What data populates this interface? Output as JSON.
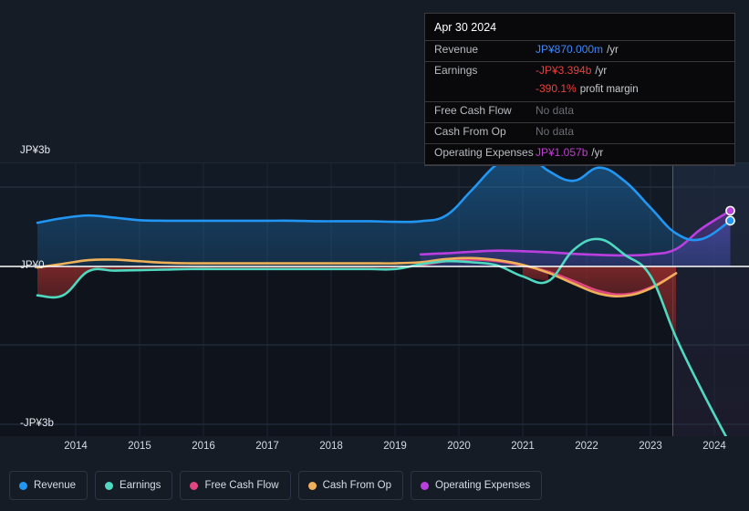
{
  "axis": {
    "y_labels": {
      "top": "JP¥3b",
      "zero": "JP¥0",
      "bottom": "-JP¥3b"
    },
    "x_labels": [
      "2014",
      "2015",
      "2016",
      "2017",
      "2018",
      "2019",
      "2020",
      "2021",
      "2022",
      "2023",
      "2024"
    ]
  },
  "tooltip": {
    "date": "Apr 30 2024",
    "rows": [
      {
        "key": "Revenue",
        "value": "JP¥870.000m",
        "unit": "/yr",
        "style": "rev"
      },
      {
        "key": "Earnings",
        "value": "-JP¥3.394b",
        "unit": "/yr",
        "style": "neg"
      },
      {
        "key": "",
        "value": "-390.1%",
        "unit": "profit margin",
        "style": "neg"
      },
      {
        "key": "Free Cash Flow",
        "value": "No data",
        "unit": "",
        "style": "nodata"
      },
      {
        "key": "Cash From Op",
        "value": "No data",
        "unit": "",
        "style": "nodata"
      },
      {
        "key": "Operating Expenses",
        "value": "JP¥1.057b",
        "unit": "/yr",
        "style": "opex"
      }
    ]
  },
  "legend": [
    {
      "label": "Revenue",
      "color": "#2196f3"
    },
    {
      "label": "Earnings",
      "color": "#4fd9c0"
    },
    {
      "label": "Free Cash Flow",
      "color": "#e0467f"
    },
    {
      "label": "Cash From Op",
      "color": "#efb05a"
    },
    {
      "label": "Operating Expenses",
      "color": "#bb3fe0"
    }
  ],
  "chart_data": {
    "type": "area",
    "title": "",
    "xlabel": "",
    "ylabel": "JP¥",
    "ylim": [
      -3.6,
      3.6
    ],
    "grid": true,
    "legend_position": "bottom",
    "currency": "JP¥",
    "zero_line": 0,
    "forecast_divider_year": 2023.35,
    "x": [
      2013.4,
      2013.8,
      2014.2,
      2014.6,
      2015.0,
      2015.4,
      2015.8,
      2016.2,
      2016.6,
      2017.0,
      2017.4,
      2017.8,
      2018.2,
      2018.6,
      2019.0,
      2019.4,
      2019.8,
      2020.2,
      2020.6,
      2021.0,
      2021.4,
      2021.8,
      2022.2,
      2022.6,
      2023.0,
      2023.4,
      2023.8,
      2024.25
    ],
    "series": [
      {
        "name": "Revenue",
        "color": "#2196f3",
        "values": [
          0.83,
          0.92,
          0.97,
          0.93,
          0.88,
          0.87,
          0.87,
          0.87,
          0.87,
          0.87,
          0.87,
          0.86,
          0.86,
          0.86,
          0.85,
          0.86,
          0.97,
          1.45,
          1.95,
          2.18,
          1.82,
          1.63,
          1.88,
          1.62,
          1.12,
          0.63,
          0.52,
          0.87
        ]
      },
      {
        "name": "Earnings",
        "color": "#4fd9c0",
        "values": [
          -0.55,
          -0.55,
          -0.09,
          -0.08,
          -0.07,
          -0.06,
          -0.05,
          -0.05,
          -0.05,
          -0.05,
          -0.05,
          -0.05,
          -0.05,
          -0.05,
          -0.05,
          0.04,
          0.1,
          0.08,
          0.02,
          -0.19,
          -0.28,
          0.32,
          0.52,
          0.22,
          -0.18,
          -1.35,
          -2.35,
          -3.39
        ]
      },
      {
        "name": "Free Cash Flow",
        "color": "#e0467f",
        "values": [
          null,
          null,
          null,
          null,
          null,
          null,
          null,
          null,
          null,
          null,
          null,
          null,
          null,
          null,
          null,
          0.02,
          0.1,
          0.13,
          0.1,
          0.02,
          -0.1,
          -0.28,
          -0.47,
          -0.53,
          -0.4,
          -0.13,
          null,
          null
        ]
      },
      {
        "name": "Cash From Op",
        "color": "#efb05a",
        "values": [
          -0.02,
          0.05,
          0.12,
          0.13,
          0.1,
          0.07,
          0.06,
          0.06,
          0.06,
          0.06,
          0.06,
          0.06,
          0.06,
          0.06,
          0.06,
          0.08,
          0.14,
          0.16,
          0.12,
          0.03,
          -0.12,
          -0.33,
          -0.52,
          -0.56,
          -0.42,
          -0.13,
          null,
          null
        ]
      },
      {
        "name": "Operating Expenses",
        "color": "#bb3fe0",
        "values": [
          null,
          null,
          null,
          null,
          null,
          null,
          null,
          null,
          null,
          null,
          null,
          null,
          null,
          null,
          null,
          0.23,
          0.25,
          0.28,
          0.3,
          0.29,
          0.27,
          0.24,
          0.22,
          0.21,
          0.23,
          0.33,
          0.72,
          1.06
        ]
      }
    ],
    "endpoints": [
      {
        "series": "Operating Expenses",
        "x": 2024.25,
        "y": 1.06,
        "color": "#bb3fe0"
      },
      {
        "series": "Revenue",
        "x": 2024.25,
        "y": 0.87,
        "color": "#2196f3"
      },
      {
        "series": "Earnings",
        "x": 2024.25,
        "y": -3.39,
        "color": "#4fd9c0"
      }
    ]
  }
}
